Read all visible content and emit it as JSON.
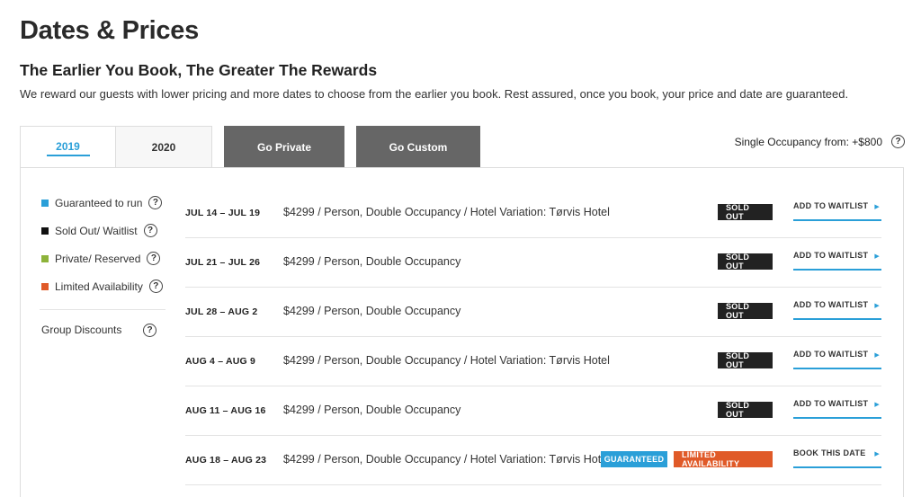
{
  "page": {
    "title": "Dates & Prices",
    "subtitle": "The Earlier You Book, The Greater The Rewards",
    "intro": "We reward our guests with lower pricing and more dates to choose from the earlier you book. Rest assured, once you book, your price and date are guaranteed."
  },
  "tabs": {
    "year_2019": "2019",
    "year_2020": "2020",
    "private": "Go Private",
    "custom": "Go Custom"
  },
  "single_occupancy": "Single Occupancy from: +$800",
  "help_glyph": "?",
  "legend": {
    "guaranteed": {
      "label": "Guaranteed to run",
      "color": "#2a9fd8"
    },
    "sold_out": {
      "label": "Sold Out/ Waitlist",
      "color": "#111111"
    },
    "private": {
      "label": "Private/ Reserved",
      "color": "#8db33a"
    },
    "limited": {
      "label": "Limited Availability",
      "color": "#e05a28"
    },
    "group_discounts": "Group Discounts"
  },
  "rows": [
    {
      "dates": "JUL 14 – JUL 19",
      "desc": "$4299 / Person, Double Occupancy / Hotel Variation: Tørvis Hotel",
      "badge": "SOLD OUT",
      "action": "ADD TO WAITLIST"
    },
    {
      "dates": "JUL 21 – JUL 26",
      "desc": "$4299 / Person, Double Occupancy",
      "badge": "SOLD OUT",
      "action": "ADD TO WAITLIST"
    },
    {
      "dates": "JUL 28 – AUG 2",
      "desc": "$4299 / Person, Double Occupancy",
      "badge": "SOLD OUT",
      "action": "ADD TO WAITLIST"
    },
    {
      "dates": "AUG 4 – AUG 9",
      "desc": "$4299 / Person, Double Occupancy / Hotel Variation: Tørvis Hotel",
      "badge": "SOLD OUT",
      "action": "ADD TO WAITLIST"
    },
    {
      "dates": "AUG 11 – AUG 16",
      "desc": "$4299 / Person, Double Occupancy",
      "badge": "SOLD OUT",
      "action": "ADD TO WAITLIST"
    },
    {
      "dates": "AUG 18 – AUG 23",
      "desc": "$4299 / Person, Double Occupancy / Hotel Variation: Tørvis Hotel",
      "badge_guaranteed": "GUARANTEED",
      "badge_limited": "LIMITED AVAILABILITY",
      "action": "BOOK THIS DATE"
    }
  ],
  "arrow_glyph": "▶"
}
